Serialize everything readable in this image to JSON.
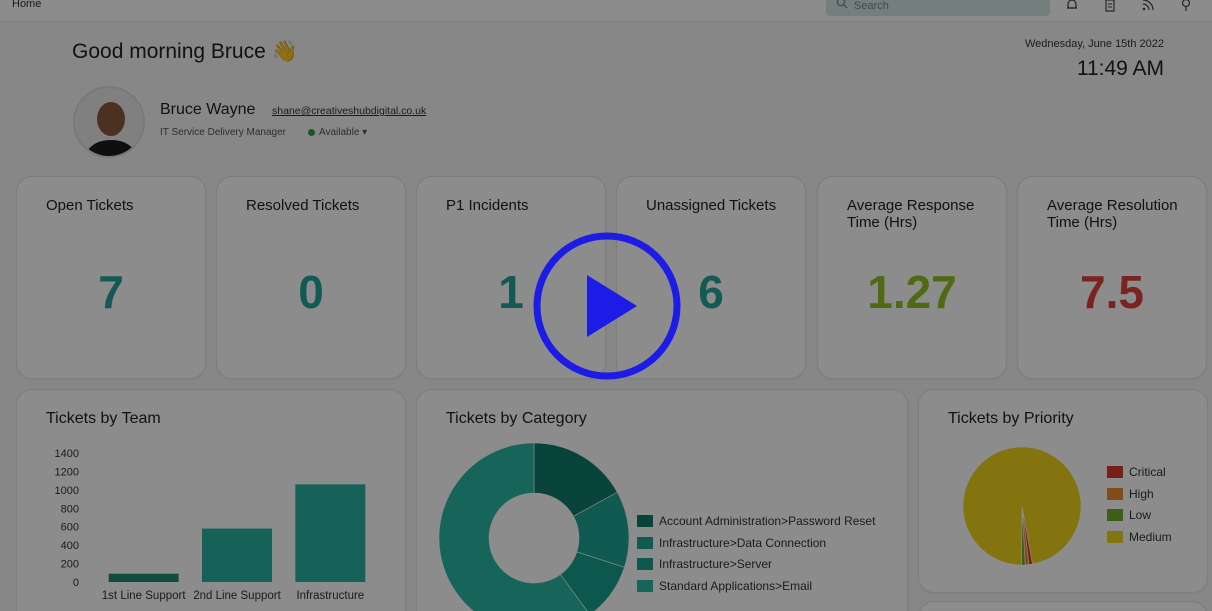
{
  "topbar": {
    "breadcrumb": "Home",
    "search_placeholder": "Search",
    "icons": [
      "bell-icon",
      "clipboard-icon",
      "rss-icon",
      "lightbulb-icon"
    ]
  },
  "greeting": {
    "text": "Good morning Bruce",
    "emoji": "👋"
  },
  "datetime": {
    "date": "Wednesday, June 15th 2022",
    "time": "11:49 AM"
  },
  "user": {
    "name": "Bruce Wayne",
    "email": "shane@creativeshubdigital.co.uk",
    "role": "IT Service Delivery Manager",
    "status": "Available"
  },
  "stats": [
    {
      "title": "Open Tickets",
      "value": "7",
      "color": "#25a59a"
    },
    {
      "title": "Resolved Tickets",
      "value": "0",
      "color": "#25a59a"
    },
    {
      "title": "P1 Incidents",
      "value": "1",
      "color": "#25a59a"
    },
    {
      "title": "Unassigned Tickets",
      "value": "6",
      "color": "#25a59a"
    },
    {
      "title": "Average Response Time (Hrs)",
      "value": "1.27",
      "color": "#8fc31f"
    },
    {
      "title": "Average Resolution Time (Hrs)",
      "value": "7.5",
      "color": "#e0433a"
    }
  ],
  "chart_data": [
    {
      "type": "bar",
      "title": "Tickets by Team",
      "categories": [
        "1st Line Support",
        "2nd Line Support",
        "Infrastructure"
      ],
      "values": [
        90,
        580,
        1060
      ],
      "ylim": [
        0,
        1400
      ],
      "yticks": [
        0,
        200,
        400,
        600,
        800,
        1000,
        1200,
        1400
      ],
      "colors": [
        "#1f8a7b",
        "#2ab3a0",
        "#2ab3a0"
      ]
    },
    {
      "type": "pie",
      "title": "Tickets by Category",
      "donut": true,
      "categories": [
        "Account Administration>Password Reset",
        "Infrastructure>Data Connection",
        "Infrastructure>Server",
        "Standard Applications>Email"
      ],
      "values": [
        17,
        13,
        10,
        60
      ],
      "colors": [
        "#0f7a6e",
        "#1fa596",
        "#19a08f",
        "#2ab7a5"
      ]
    },
    {
      "type": "pie",
      "title": "Tickets by Priority",
      "categories": [
        "Critical",
        "High",
        "Low",
        "Medium"
      ],
      "values": [
        1,
        1,
        1,
        97
      ],
      "colors": [
        "#d93b2a",
        "#e98b2e",
        "#6dab2b",
        "#f1d31c"
      ]
    }
  ],
  "accent": "#25a59a"
}
